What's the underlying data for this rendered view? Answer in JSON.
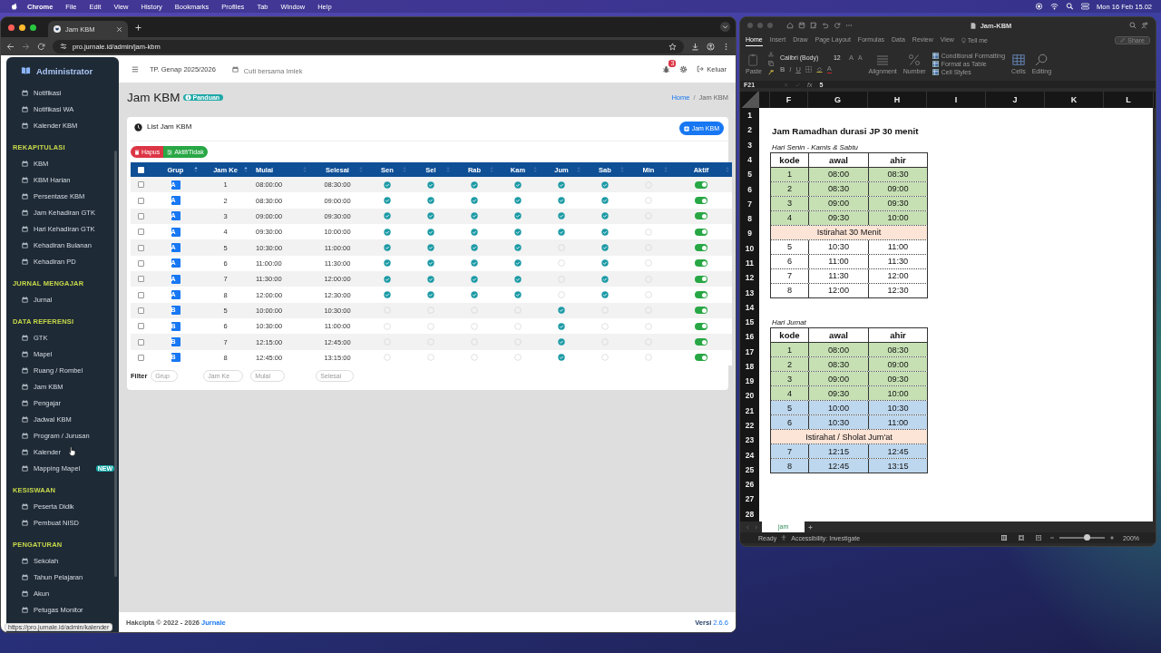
{
  "menubar": {
    "items": [
      "Chrome",
      "File",
      "Edit",
      "View",
      "History",
      "Bookmarks",
      "Profiles",
      "Tab",
      "Window",
      "Help"
    ],
    "clock": "Mon 16 Feb 15.02"
  },
  "browser": {
    "tab": {
      "title": "Jam KBM",
      "selected": true
    },
    "url": "pro.jurnale.id/admin/jam-kbm",
    "status_url": "https://pro.jurnale.id/admin/kalender"
  },
  "sidebar": {
    "brand": "Administrator",
    "sections": [
      {
        "items": [
          {
            "label": "Notifikasi",
            "selected": false
          },
          {
            "label": "Notifikasi WA",
            "selected": false
          },
          {
            "label": "Kalender KBM",
            "selected": false
          }
        ]
      },
      {
        "heading": "REKAPITULASI",
        "items": [
          {
            "label": "KBM",
            "selected": false
          },
          {
            "label": "KBM Harian",
            "selected": false
          },
          {
            "label": "Persentase KBM",
            "selected": false
          },
          {
            "label": "Jam Kehadiran GTK",
            "selected": false
          },
          {
            "label": "Hari Kehadiran GTK",
            "selected": false
          },
          {
            "label": "Kehadiran Bulanan",
            "selected": false
          },
          {
            "label": "Kehadiran PD",
            "selected": false
          }
        ]
      },
      {
        "heading": "JURNAL MENGAJAR",
        "items": [
          {
            "label": "Jurnal",
            "selected": false
          }
        ]
      },
      {
        "heading": "DATA REFERENSI",
        "items": [
          {
            "label": "GTK",
            "selected": false
          },
          {
            "label": "Mapel",
            "selected": false
          },
          {
            "label": "Ruang / Rombel",
            "selected": false
          },
          {
            "label": "Jam KBM",
            "selected": false
          },
          {
            "label": "Pengajar",
            "selected": false
          },
          {
            "label": "Jadwal KBM",
            "selected": false
          },
          {
            "label": "Program / Jurusan",
            "selected": false
          },
          {
            "label": "Kalender",
            "selected": false
          },
          {
            "label": "Mapping Mapel",
            "selected": false,
            "badge": "NEW"
          }
        ]
      },
      {
        "heading": "KESISWAAN",
        "items": [
          {
            "label": "Peserta Didik",
            "selected": false
          },
          {
            "label": "Pembuat NISD",
            "selected": false
          }
        ]
      },
      {
        "heading": "PENGATURAN",
        "items": [
          {
            "label": "Sekolah",
            "selected": false
          },
          {
            "label": "Tahun Pelajaran",
            "selected": false
          },
          {
            "label": "Akun",
            "selected": false
          },
          {
            "label": "Petugas Monitor",
            "selected": false
          }
        ]
      }
    ]
  },
  "header": {
    "school_year": "TP. Genap 2025/2026",
    "event": "Cuti bersama Imlek",
    "notification_count": "3",
    "logout": "Keluar"
  },
  "page": {
    "title": "Jam KBM",
    "guide": "Panduan",
    "breadcrumb": [
      "Home",
      "Jam KBM"
    ],
    "breadcrumb_separator": "/"
  },
  "card": {
    "title": "List Jam KBM",
    "add_button": "Jam KBM",
    "actions": [
      {
        "label": "Hapus",
        "kind": "delete"
      },
      {
        "label": "Aktif/Tidak",
        "kind": "toggle"
      }
    ],
    "select_all_checked": false,
    "columns": [
      "Grup",
      "Jam Ke",
      "Mulai",
      "Selesai",
      "Sen",
      "Sel",
      "Rab",
      "Kam",
      "Jum",
      "Sab",
      "Min",
      "Aktif"
    ],
    "rows": [
      {
        "checked": false,
        "group": "A",
        "jam_ke": "1",
        "start": "08:00:00",
        "end": "08:30:00",
        "days": [
          true,
          true,
          true,
          true,
          true,
          true,
          false
        ],
        "active": true
      },
      {
        "checked": false,
        "group": "A",
        "jam_ke": "2",
        "start": "08:30:00",
        "end": "09:00:00",
        "days": [
          true,
          true,
          true,
          true,
          true,
          true,
          false
        ],
        "active": true
      },
      {
        "checked": false,
        "group": "A",
        "jam_ke": "3",
        "start": "09:00:00",
        "end": "09:30:00",
        "days": [
          true,
          true,
          true,
          true,
          true,
          true,
          false
        ],
        "active": true
      },
      {
        "checked": false,
        "group": "A",
        "jam_ke": "4",
        "start": "09:30:00",
        "end": "10:00:00",
        "days": [
          true,
          true,
          true,
          true,
          true,
          true,
          false
        ],
        "active": true
      },
      {
        "checked": false,
        "group": "A",
        "jam_ke": "5",
        "start": "10:30:00",
        "end": "11:00:00",
        "days": [
          true,
          true,
          true,
          true,
          false,
          true,
          false
        ],
        "active": true
      },
      {
        "checked": false,
        "group": "A",
        "jam_ke": "6",
        "start": "11:00:00",
        "end": "11:30:00",
        "days": [
          true,
          true,
          true,
          true,
          false,
          true,
          false
        ],
        "active": true
      },
      {
        "checked": false,
        "group": "A",
        "jam_ke": "7",
        "start": "11:30:00",
        "end": "12:00:00",
        "days": [
          true,
          true,
          true,
          true,
          false,
          true,
          false
        ],
        "active": true
      },
      {
        "checked": false,
        "group": "A",
        "jam_ke": "8",
        "start": "12:00:00",
        "end": "12:30:00",
        "days": [
          true,
          true,
          true,
          true,
          false,
          true,
          false
        ],
        "active": true
      },
      {
        "checked": false,
        "group": "B",
        "jam_ke": "5",
        "start": "10:00:00",
        "end": "10:30:00",
        "days": [
          false,
          false,
          false,
          false,
          true,
          false,
          false
        ],
        "active": true
      },
      {
        "checked": false,
        "group": "B",
        "jam_ke": "6",
        "start": "10:30:00",
        "end": "11:00:00",
        "days": [
          false,
          false,
          false,
          false,
          true,
          false,
          false
        ],
        "active": true
      },
      {
        "checked": false,
        "group": "B",
        "jam_ke": "7",
        "start": "12:15:00",
        "end": "12:45:00",
        "days": [
          false,
          false,
          false,
          false,
          true,
          false,
          false
        ],
        "active": true
      },
      {
        "checked": false,
        "group": "B",
        "jam_ke": "8",
        "start": "12:45:00",
        "end": "13:15:00",
        "days": [
          false,
          false,
          false,
          false,
          true,
          false,
          false
        ],
        "active": true
      }
    ],
    "filter": {
      "label": "Filter",
      "fields": [
        {
          "placeholder": "Grup"
        },
        {
          "placeholder": "Jam Ke"
        },
        {
          "placeholder": "Mulai"
        },
        {
          "placeholder": "Selesai"
        }
      ]
    }
  },
  "footer": {
    "copyright": "Hakcipta © 2022 - 2026",
    "brand": "Jurnale",
    "version_label": "Versi",
    "version": "2.6.6"
  },
  "excel": {
    "title": "Jam-KBM",
    "tabs": [
      {
        "label": "Home",
        "selected": true
      },
      {
        "label": "Insert",
        "selected": false
      },
      {
        "label": "Draw",
        "selected": false
      },
      {
        "label": "Page Layout",
        "selected": false
      },
      {
        "label": "Formulas",
        "selected": false
      },
      {
        "label": "Data",
        "selected": false
      },
      {
        "label": "Review",
        "selected": false
      },
      {
        "label": "View",
        "selected": false
      }
    ],
    "tell_me": "Tell me",
    "share": "Share",
    "paste": "Paste",
    "font_name": "Calibri (Body)",
    "font_size": "12",
    "size_buttons": [
      "A",
      "A"
    ],
    "style_buttons": [
      "B",
      "I",
      "U"
    ],
    "font_color_button": "A",
    "alignment": "Alignment",
    "number": "Number",
    "style_commands": [
      "Conditional Formatting",
      "Format as Table",
      "Cell Styles"
    ],
    "cells": "Cells",
    "editing": "Editing",
    "name_box": "F21",
    "fx": "fx",
    "formula": "5",
    "columns": [
      "F",
      "G",
      "H",
      "I",
      "J",
      "K",
      "L"
    ],
    "row_numbers": [
      "1",
      "2",
      "3",
      "4",
      "5",
      "6",
      "7",
      "8",
      "9",
      "10",
      "11",
      "12",
      "13",
      "14",
      "15",
      "16",
      "17",
      "18",
      "19",
      "20",
      "21",
      "22",
      "23",
      "24",
      "25",
      "26",
      "27",
      "28"
    ],
    "sheet_title": "Jam Ramadhan durasi JP 30 menit",
    "blocks": [
      {
        "caption": "Hari Senin - Kamis & Sabtu",
        "header": [
          "kode",
          "awal",
          "ahir"
        ],
        "rows": [
          {
            "kind": "time",
            "color": "#c6e0b4",
            "cells": [
              "1",
              "08:00",
              "08:30"
            ]
          },
          {
            "kind": "time",
            "color": "#c6e0b4",
            "cells": [
              "2",
              "08:30",
              "09:00"
            ]
          },
          {
            "kind": "time",
            "color": "#c6e0b4",
            "cells": [
              "3",
              "09:00",
              "09:30"
            ]
          },
          {
            "kind": "time",
            "color": "#c6e0b4",
            "cells": [
              "4",
              "09:30",
              "10:00"
            ]
          },
          {
            "kind": "break",
            "color": "#fce4d6",
            "text": "Istirahat 30 Menit"
          },
          {
            "kind": "time",
            "color": "#ffffff",
            "cells": [
              "5",
              "10:30",
              "11:00"
            ]
          },
          {
            "kind": "time",
            "color": "#ffffff",
            "cells": [
              "6",
              "11:00",
              "11:30"
            ]
          },
          {
            "kind": "time",
            "color": "#ffffff",
            "cells": [
              "7",
              "11:30",
              "12:00"
            ]
          },
          {
            "kind": "time",
            "color": "#ffffff",
            "cells": [
              "8",
              "12:00",
              "12:30"
            ]
          }
        ]
      },
      {
        "caption": "Hari Jumat",
        "header": [
          "kode",
          "awal",
          "ahir"
        ],
        "rows": [
          {
            "kind": "time",
            "color": "#c6e0b4",
            "cells": [
              "1",
              "08:00",
              "08:30"
            ]
          },
          {
            "kind": "time",
            "color": "#c6e0b4",
            "cells": [
              "2",
              "08:30",
              "09:00"
            ]
          },
          {
            "kind": "time",
            "color": "#c6e0b4",
            "cells": [
              "3",
              "09:00",
              "09:30"
            ]
          },
          {
            "kind": "time",
            "color": "#c6e0b4",
            "cells": [
              "4",
              "09:30",
              "10:00"
            ]
          },
          {
            "kind": "time",
            "color": "#bdd7ee",
            "cells": [
              "5",
              "10:00",
              "10:30"
            ]
          },
          {
            "kind": "time",
            "color": "#bdd7ee",
            "cells": [
              "6",
              "10:30",
              "11:00"
            ]
          },
          {
            "kind": "break",
            "color": "#fce4d6",
            "text": "Istirahat / Sholat Jum'at"
          },
          {
            "kind": "time",
            "color": "#bdd7ee",
            "cells": [
              "7",
              "12:15",
              "12:45"
            ]
          },
          {
            "kind": "time",
            "color": "#bdd7ee",
            "cells": [
              "8",
              "12:45",
              "13:15"
            ]
          }
        ]
      }
    ],
    "sheet_tabs": [
      {
        "label": "jam",
        "selected": true
      }
    ],
    "status": "Ready",
    "accessibility": "Accessibility: Investigate",
    "zoom": "200%",
    "zoom_slider": {
      "level": 0.6
    }
  }
}
